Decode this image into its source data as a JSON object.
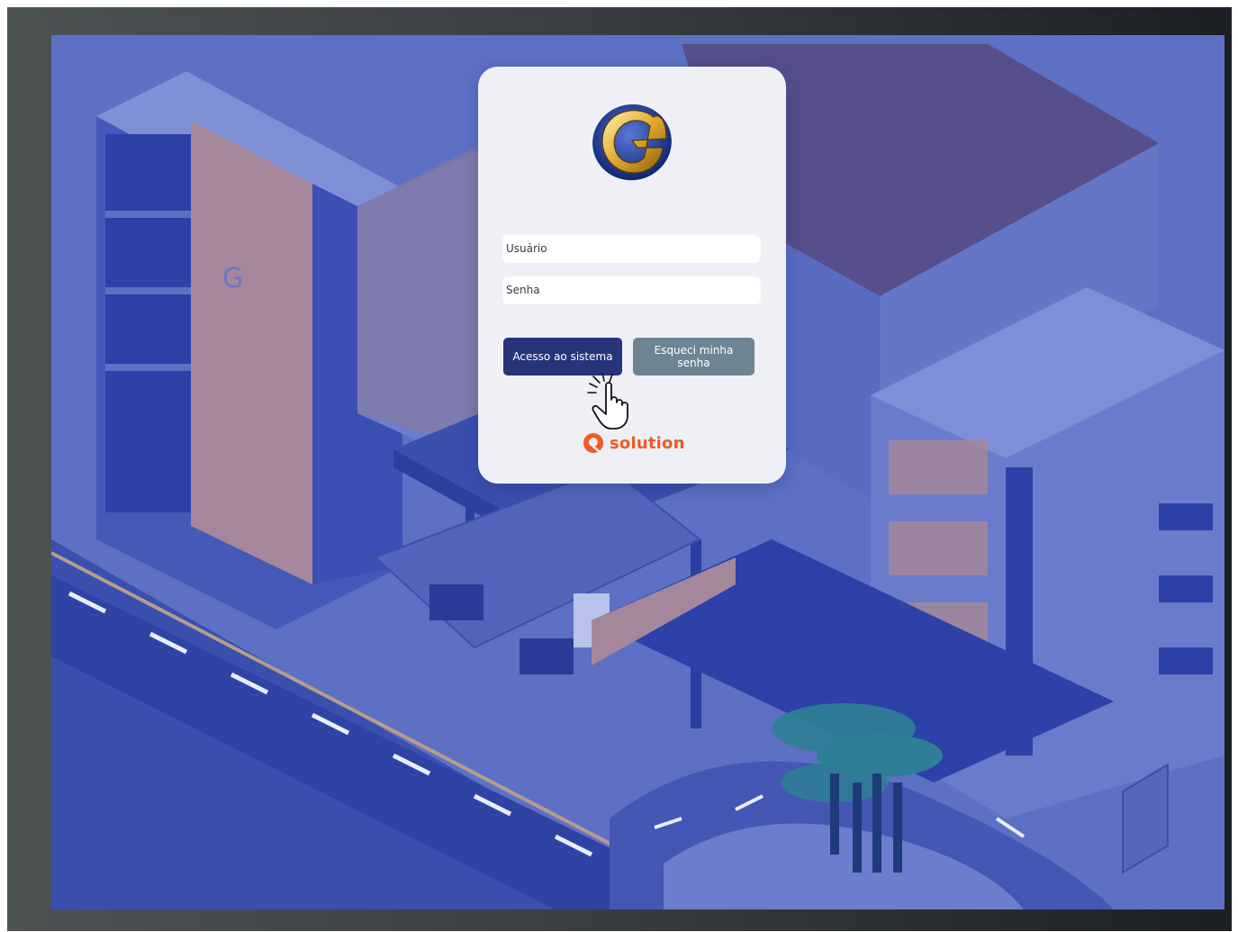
{
  "login": {
    "username_placeholder": "Usuário",
    "password_placeholder": "Senha",
    "access_button": "Acesso ao sistema",
    "forgot_button": "Esqueci minha senha"
  },
  "brand": {
    "text": "solution",
    "color": "#f25a22"
  },
  "colors": {
    "primary_button": "#27347c",
    "secondary_button": "#6f8492",
    "background_tint": "#5b6ec2"
  },
  "icons": {
    "logo": "company-g-logo-icon",
    "pointer": "hand-pointer-icon",
    "brand": "solution-logo-icon"
  }
}
